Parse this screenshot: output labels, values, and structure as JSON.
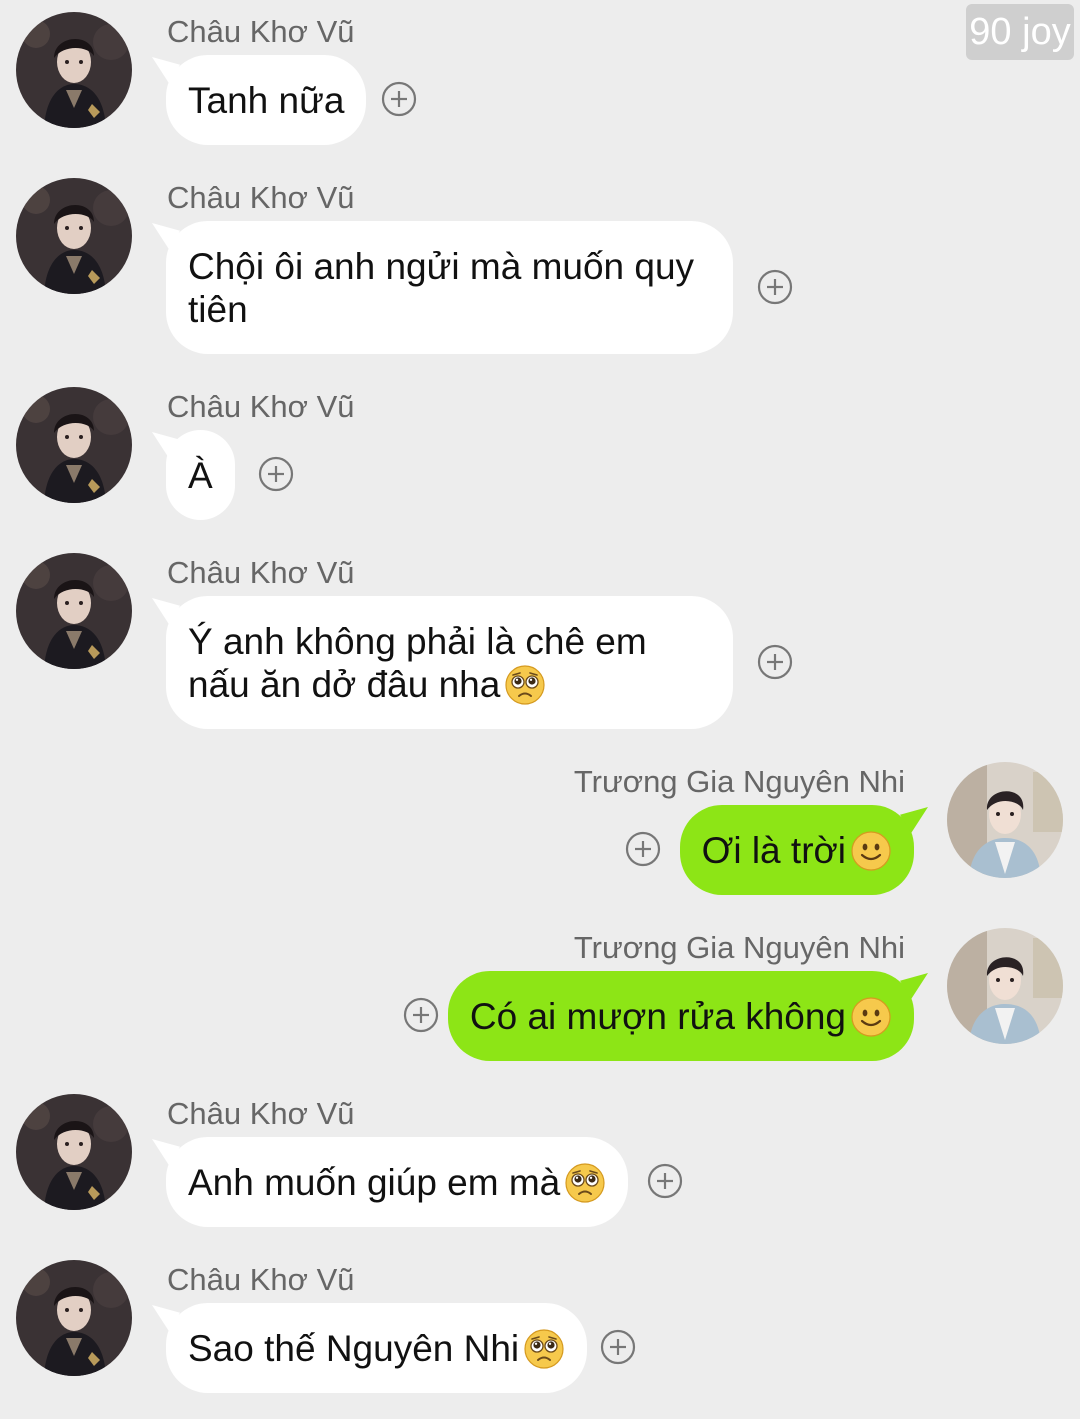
{
  "watermark": "90 joy",
  "colors": {
    "background": "#ededed",
    "incoming_bubble": "#ffffff",
    "outgoing_bubble": "#8de516",
    "name_text": "#666666"
  },
  "messages": [
    {
      "sender": "Châu Khơ Vũ",
      "direction": "incoming",
      "text": "Tanh nữa",
      "emoji": ""
    },
    {
      "sender": "Châu Khơ Vũ",
      "direction": "incoming",
      "text": "Chội ôi anh ngửi mà muốn quy tiên",
      "emoji": ""
    },
    {
      "sender": "Châu Khơ Vũ",
      "direction": "incoming",
      "text": "À",
      "emoji": ""
    },
    {
      "sender": "Châu Khơ Vũ",
      "direction": "incoming",
      "text": "Ý anh không phải là chê em nấu ăn dở đâu nha",
      "emoji": "pleading-face-icon"
    },
    {
      "sender": "Trương Gia Nguyên Nhi",
      "direction": "outgoing",
      "text": "Ơi là trời",
      "emoji": "smiling-face-icon"
    },
    {
      "sender": "Trương Gia Nguyên Nhi",
      "direction": "outgoing",
      "text": "Có ai mượn rửa không",
      "emoji": "smiling-face-icon"
    },
    {
      "sender": "Châu Khơ Vũ",
      "direction": "incoming",
      "text": "Anh muốn giúp em mà",
      "emoji": "pleading-face-icon"
    },
    {
      "sender": "Châu Khơ Vũ",
      "direction": "incoming",
      "text": "Sao thế Nguyên Nhi",
      "emoji": "pleading-face-icon"
    }
  ]
}
